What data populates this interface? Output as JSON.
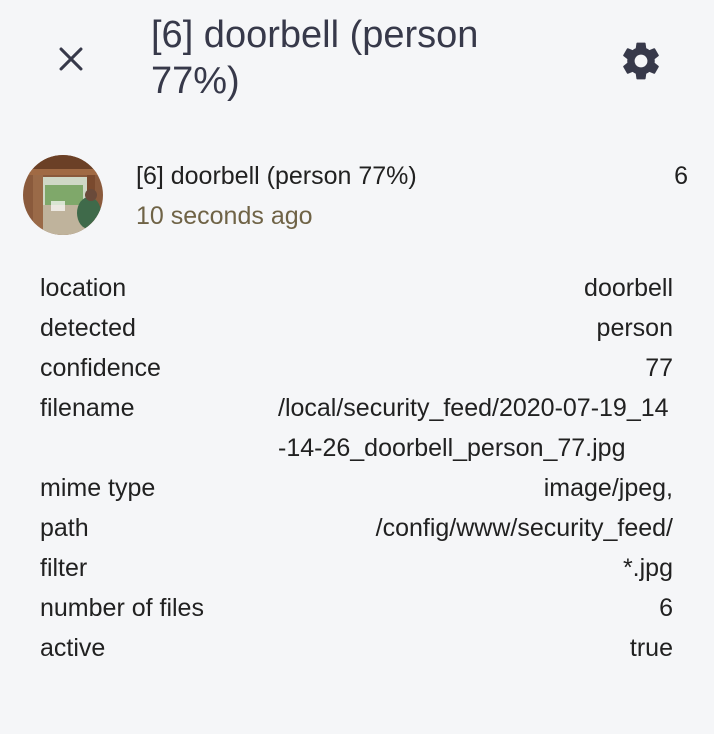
{
  "header": {
    "title": "[6] doorbell (person 77%)",
    "close_icon": "close-icon",
    "settings_icon": "gear-icon"
  },
  "entity": {
    "name": "[6] doorbell (person 77%)",
    "time": "10 seconds ago",
    "state": "6"
  },
  "attributes": {
    "rows": [
      {
        "key": "location",
        "value": "doorbell"
      },
      {
        "key": "detected",
        "value": "person"
      },
      {
        "key": "confidence",
        "value": "77"
      },
      {
        "key": "filename",
        "value": "/local/security_feed/2020-07-19_14-14-26_doorbell_person_77.jpg"
      },
      {
        "key": "mime type",
        "value": "image/jpeg,"
      },
      {
        "key": "path",
        "value": "/config/www/security_feed/"
      },
      {
        "key": "filter",
        "value": "*.jpg"
      },
      {
        "key": "number of files",
        "value": "6"
      },
      {
        "key": "active",
        "value": "true"
      }
    ]
  },
  "colors": {
    "background": "#f5f6f8",
    "title": "#37394a",
    "secondary_text": "#6f6346"
  }
}
